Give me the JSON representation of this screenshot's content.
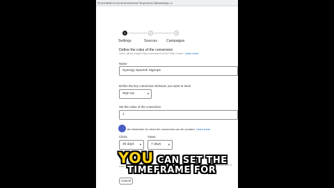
{
  "url": "/5122480/c/conversions/new?imported=false&step=1",
  "stepper": {
    "steps": [
      {
        "number": "1",
        "label": "Settings"
      },
      {
        "number": "2",
        "label": "Sources"
      },
      {
        "number": "3",
        "label": "Campaigns"
      }
    ]
  },
  "form": {
    "heading": "Define the rules of the conversion",
    "subtext": "Learn about Insight Tag conversions at the Help Center.",
    "subtext_link": "Learn more",
    "name_label": "Name",
    "name_value": "Synergy Spanish Signups",
    "behavior_label": "Define the key conversion behavior you want to track",
    "behavior_value": "Sign Up",
    "value_label": "Set the value of the conversion",
    "value_value": "1",
    "timeframe_label": "the timeframe for when the conversion can be counted.",
    "timeframe_link": "Learn more",
    "clicks_label": "Clicks",
    "clicks_value": "30 days",
    "views_label": "Views",
    "views_value": "7 days",
    "partial_left": "conv",
    "partial_right_1": "ined",
    "partial_right_2": "a conversion a",
    "cancel_label": "Cancel"
  },
  "caption": {
    "line1_highlight": "YOU",
    "line1_rest": "CAN SET THE",
    "line2": "TIMEFRAME FOR"
  },
  "colors": {
    "highlight": "#ffd11a",
    "help_dot": "#4a5ec4",
    "link": "#0a66c2"
  }
}
